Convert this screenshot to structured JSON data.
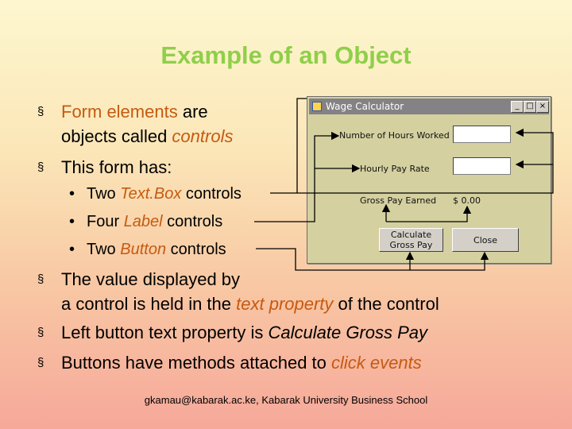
{
  "slide": {
    "title": "Example of an Object",
    "bullets": {
      "b1_a": "Form elements",
      "b1_b": " are",
      "b1_c": "objects called ",
      "b1_d": "controls",
      "b2": "This form has:",
      "s1_a": "Two ",
      "s1_b": "Text.Box",
      "s1_c": " controls",
      "s2_a": "Four ",
      "s2_b": "Label",
      "s2_c": " controls",
      "s3_a": "Two ",
      "s3_b": "Button",
      "s3_c": " controls",
      "b3_a": "The value displayed by",
      "b3_b": "a control is held in the ",
      "b3_c": "text property",
      "b3_d": " of the control",
      "b4_a": "Left button text property is ",
      "b4_b": "Calculate Gross Pay",
      "b5_a": "Buttons have methods attached to ",
      "b5_b": "click events"
    },
    "bullet_mark": "§",
    "sub_mark": "•",
    "footer": "gkamau@kabarak.ac.ke, Kabarak University Business School"
  },
  "window": {
    "title": "Wage Calculator",
    "min": "_",
    "max": "□",
    "close": "×",
    "label_hours": "Number of Hours Worked",
    "label_rate": "Hourly Pay Rate",
    "label_gross": "Gross Pay Earned",
    "gross_value": "$ 0.00",
    "hours_value": "",
    "rate_value": "",
    "calc_button": "Calculate Gross Pay",
    "close_button": "Close"
  },
  "colors": {
    "title": "#8fcf4a",
    "accent": "#c55a11",
    "window_bg": "#d4d0a0"
  }
}
